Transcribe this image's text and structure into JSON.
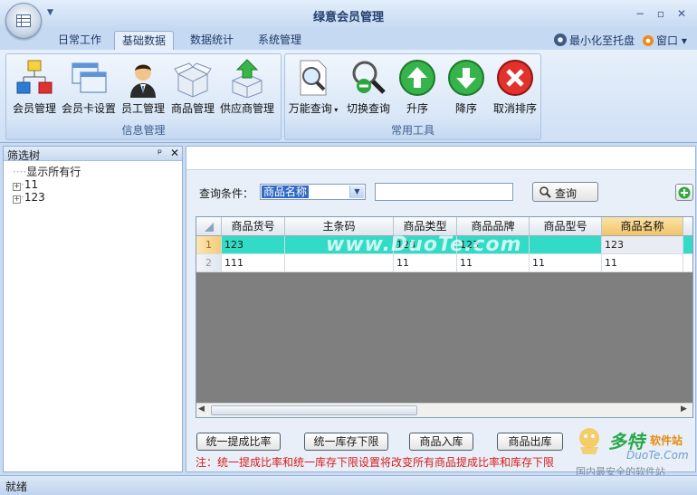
{
  "app": {
    "title": "绿意会员管理"
  },
  "tabs": [
    "日常工作",
    "基础数据",
    "数据统计",
    "系统管理"
  ],
  "active_tab": "基础数据",
  "tray_label": "最小化至托盘",
  "window_label": "窗口",
  "ribbon": {
    "info_group": {
      "label": "信息管理",
      "buttons": [
        "会员管理",
        "会员卡设置",
        "员工管理",
        "商品管理",
        "供应商管理"
      ]
    },
    "tools_group": {
      "label": "常用工具",
      "buttons": [
        "万能查询",
        "切换查询",
        "升序",
        "降序",
        "取消排序"
      ]
    }
  },
  "left_panel": {
    "title": "筛选树",
    "items": [
      "显示所有行",
      "11",
      "123"
    ]
  },
  "query": {
    "label": "查询条件：",
    "selected": "商品名称",
    "input_value": "",
    "button": "查询"
  },
  "grid": {
    "columns": [
      "商品货号",
      "主条码",
      "商品类型",
      "商品品牌",
      "商品型号",
      "商品名称"
    ],
    "rows": [
      {
        "num": "1",
        "cells": [
          "123",
          "",
          "123",
          "123",
          "",
          "123"
        ]
      },
      {
        "num": "2",
        "cells": [
          "111",
          "",
          "11",
          "11",
          "11",
          "11"
        ]
      }
    ],
    "watermark": "www.DuoTe.com"
  },
  "bottom_buttons": [
    "统一提成比率",
    "统一库存下限",
    "商品入库",
    "商品出库"
  ],
  "note": "注：统一提成比率和统一库存下限设置将改变所有商品提成比率和库存下限",
  "status": "就绪",
  "watermark": {
    "brand": "多特",
    "sub": "软件站",
    "url": "DuoTe.Com",
    "slogan": "国内最安全的软件站"
  },
  "colors": {
    "selected_row": "#31dbc5",
    "active_column_header": "#f7d27a",
    "note_text": "#d61e1e"
  }
}
